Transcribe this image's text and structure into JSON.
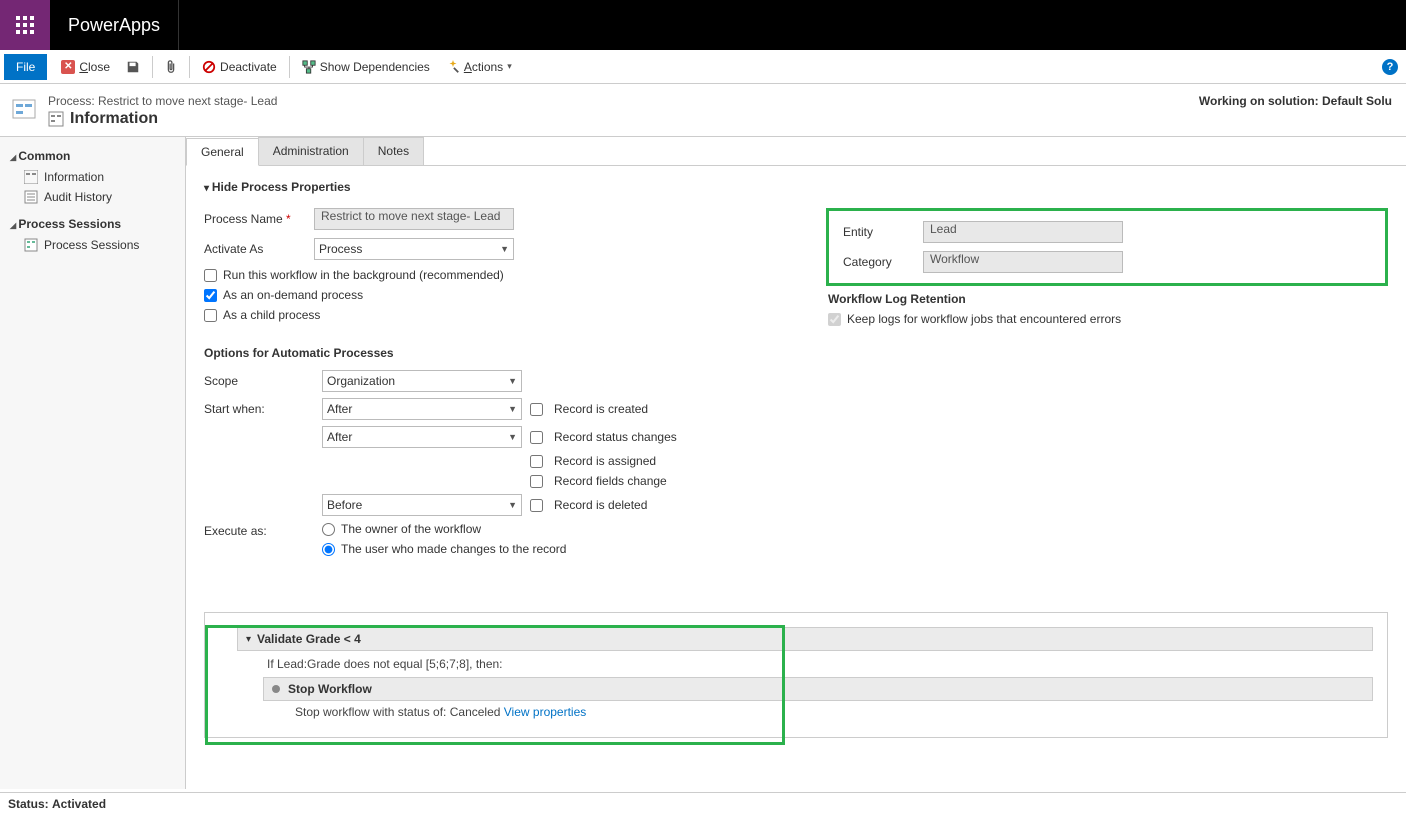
{
  "app": {
    "title": "PowerApps"
  },
  "toolbar": {
    "file": "File",
    "close": "Close",
    "deactivate": "Deactivate",
    "show_dependencies": "Show Dependencies",
    "actions": "Actions"
  },
  "header": {
    "breadcrumb": "Process: Restrict to move next stage- Lead",
    "title": "Information",
    "solution": "Working on solution: Default Solu"
  },
  "sidebar": {
    "common_hdr": "Common",
    "common": [
      {
        "label": "Information"
      },
      {
        "label": "Audit History"
      }
    ],
    "sessions_hdr": "Process Sessions",
    "sessions": [
      {
        "label": "Process Sessions"
      }
    ]
  },
  "tabs": [
    {
      "label": "General",
      "active": true
    },
    {
      "label": "Administration",
      "active": false
    },
    {
      "label": "Notes",
      "active": false
    }
  ],
  "form": {
    "hide_props": "Hide Process Properties",
    "process_name_label": "Process Name",
    "process_name_value": "Restrict to move next stage- Lead",
    "activate_as_label": "Activate As",
    "activate_as_value": "Process",
    "run_bg": "Run this workflow in the background (recommended)",
    "on_demand": "As an on-demand process",
    "as_child": "As a child process",
    "options_hdr": "Options for Automatic Processes",
    "scope_label": "Scope",
    "scope_value": "Organization",
    "start_when_label": "Start when:",
    "after1": "After",
    "after2": "After",
    "before": "Before",
    "ev_created": "Record is created",
    "ev_status": "Record status changes",
    "ev_assigned": "Record is assigned",
    "ev_fields": "Record fields change",
    "ev_deleted": "Record is deleted",
    "execute_as_label": "Execute as:",
    "exec_owner": "The owner of the workflow",
    "exec_user": "The user who made changes to the record",
    "entity_label": "Entity",
    "entity_value": "Lead",
    "category_label": "Category",
    "category_value": "Workflow",
    "log_hdr": "Workflow Log Retention",
    "keep_logs": "Keep logs for workflow jobs that encountered errors"
  },
  "steps": {
    "step1_title": "Validate Grade < 4",
    "condition": "If Lead:Grade does not equal [5;6;7;8], then:",
    "substep_title": "Stop Workflow",
    "substep_detail": "Stop workflow with status of:  Canceled  ",
    "view_props": "View properties"
  },
  "status": {
    "label": "Status:",
    "value": "Activated"
  }
}
